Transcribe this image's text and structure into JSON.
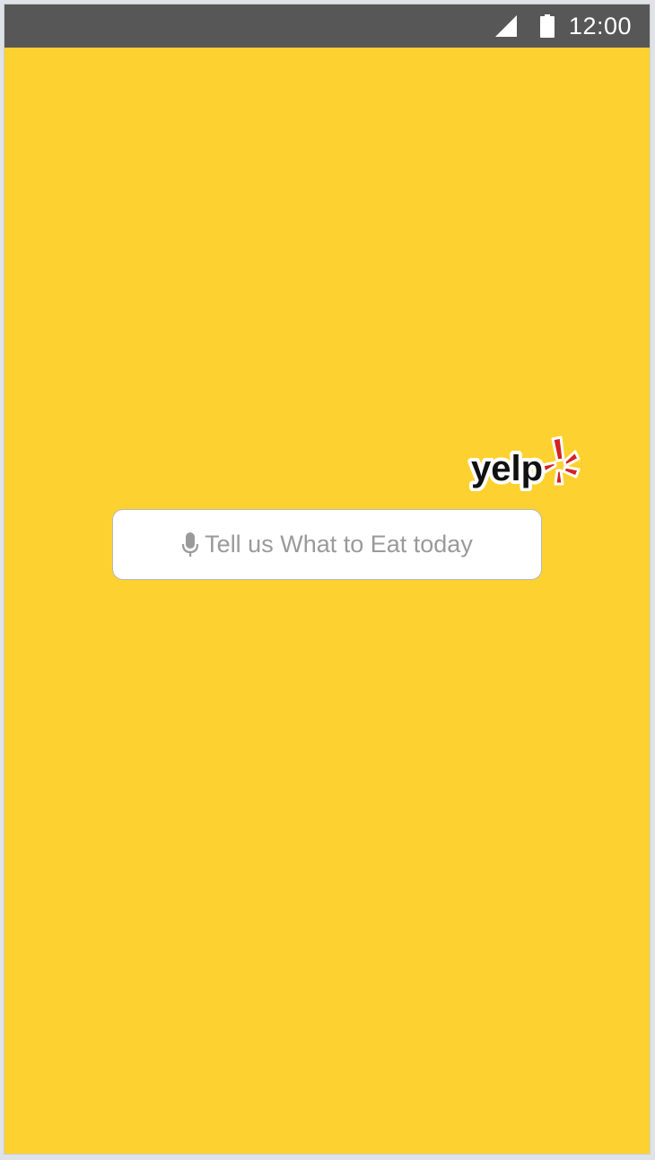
{
  "status_bar": {
    "time": "12:00",
    "icons": [
      "signal-icon",
      "battery-icon"
    ],
    "background_color": "#575757"
  },
  "screen": {
    "background_color": "#fdd230"
  },
  "logo": {
    "name": "yelp-logo",
    "text": "yelp",
    "burst_color": "#d32323"
  },
  "search": {
    "icon": "mic-icon",
    "placeholder": "Tell us What to Eat today"
  }
}
